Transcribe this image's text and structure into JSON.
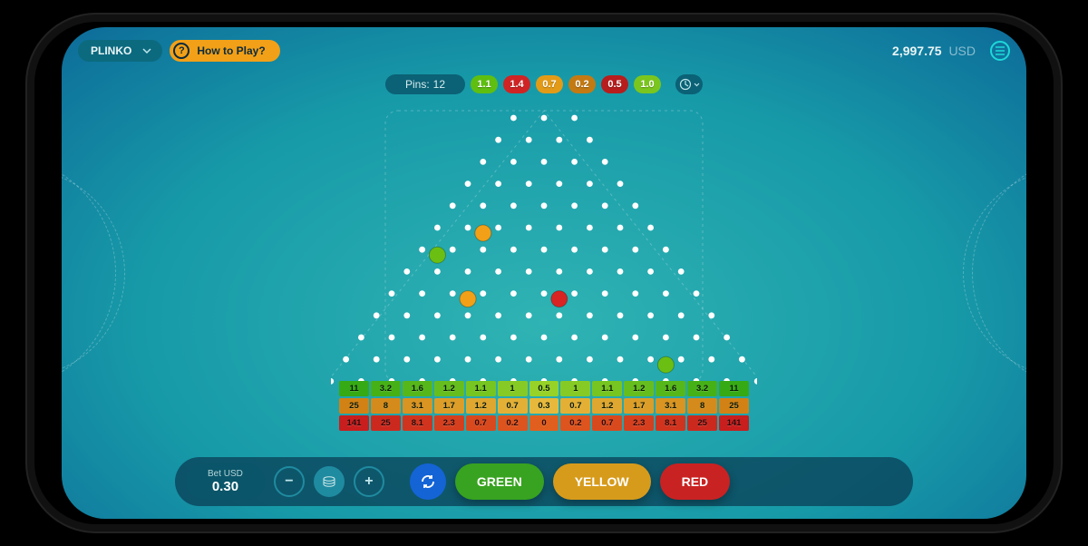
{
  "header": {
    "game_name": "PLINKO",
    "help_label": "How to Play?",
    "balance_amount": "2,997.75",
    "balance_currency": "USD"
  },
  "subbar": {
    "pins_label": "Pins:",
    "pins_value": "12",
    "history": [
      {
        "v": "1.1",
        "c": "#5fbf11"
      },
      {
        "v": "1.4",
        "c": "#d02424"
      },
      {
        "v": "0.7",
        "c": "#e39b17"
      },
      {
        "v": "0.2",
        "c": "#c47a12"
      },
      {
        "v": "0.5",
        "c": "#b71d1d"
      },
      {
        "v": "1.0",
        "c": "#7bc61e"
      }
    ]
  },
  "board": {
    "rows": 12,
    "balls": [
      {
        "row": 5,
        "col": 1,
        "color": "orange"
      },
      {
        "row": 6,
        "col": 0,
        "color": "green"
      },
      {
        "row": 8,
        "col": 2,
        "color": "orange"
      },
      {
        "row": 8,
        "col": 5,
        "color": "red"
      },
      {
        "row": 11,
        "col": 10,
        "color": "green"
      }
    ]
  },
  "payouts": {
    "green": [
      "11",
      "3.2",
      "1.6",
      "1.2",
      "1.1",
      "1",
      "0.5",
      "1",
      "1.1",
      "1.2",
      "1.6",
      "3.2",
      "11"
    ],
    "yellow": [
      "25",
      "8",
      "3.1",
      "1.7",
      "1.2",
      "0.7",
      "0.3",
      "0.7",
      "1.2",
      "1.7",
      "3.1",
      "8",
      "25"
    ],
    "red": [
      "141",
      "25",
      "8.1",
      "2.3",
      "0.7",
      "0.2",
      "0",
      "0.2",
      "0.7",
      "2.3",
      "8.1",
      "25",
      "141"
    ]
  },
  "bottom": {
    "bet_label": "Bet USD",
    "bet_amount": "0.30",
    "green_label": "GREEN",
    "yellow_label": "YELLOW",
    "red_label": "RED"
  }
}
